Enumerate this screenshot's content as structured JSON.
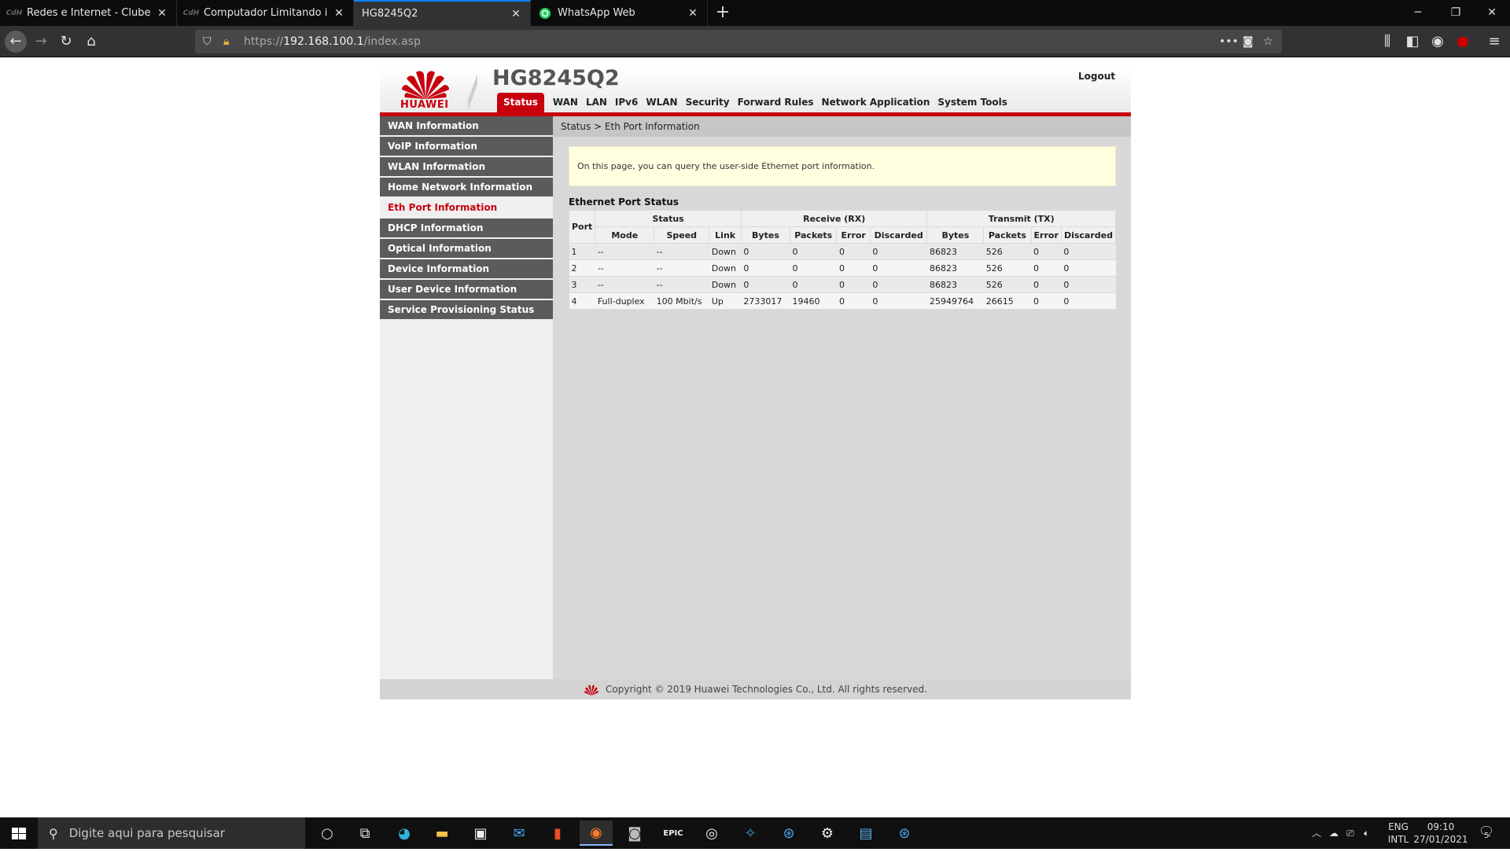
{
  "browser": {
    "tabs": [
      {
        "title": "Redes e Internet - Clube do Ha",
        "favicon": "clube-do-hardware-icon"
      },
      {
        "title": "Computador Limitando interne",
        "favicon": "clube-do-hardware-icon"
      },
      {
        "title": "HG8245Q2",
        "favicon": "none"
      },
      {
        "title": "WhatsApp Web",
        "favicon": "whatsapp-icon"
      }
    ],
    "url_prefix": "https://",
    "url_host": "192.168.100.1",
    "url_path": "/index.asp"
  },
  "router": {
    "brand": "HUAWEI",
    "model": "HG8245Q2",
    "logout": "Logout",
    "menu": [
      "Status",
      "WAN",
      "LAN",
      "IPv6",
      "WLAN",
      "Security",
      "Forward Rules",
      "Network Application",
      "System Tools"
    ],
    "sidebar": [
      "WAN Information",
      "VoIP Information",
      "WLAN Information",
      "Home Network Information",
      "Eth Port Information",
      "DHCP Information",
      "Optical Information",
      "Device Information",
      "User Device Information",
      "Service Provisioning Status"
    ],
    "breadcrumb": "Status > Eth Port Information",
    "notice": "On this page, you can query the user-side Ethernet port information.",
    "section_title": "Ethernet Port Status",
    "table": {
      "group_headers": {
        "port": "Port",
        "status": "Status",
        "rx": "Receive (RX)",
        "tx": "Transmit (TX)"
      },
      "sub_headers": [
        "Mode",
        "Speed",
        "Link",
        "Bytes",
        "Packets",
        "Error",
        "Discarded",
        "Bytes",
        "Packets",
        "Error",
        "Discarded"
      ],
      "rows": [
        [
          "1",
          "--",
          "--",
          "Down",
          "0",
          "0",
          "0",
          "0",
          "86823",
          "526",
          "0",
          "0"
        ],
        [
          "2",
          "--",
          "--",
          "Down",
          "0",
          "0",
          "0",
          "0",
          "86823",
          "526",
          "0",
          "0"
        ],
        [
          "3",
          "--",
          "--",
          "Down",
          "0",
          "0",
          "0",
          "0",
          "86823",
          "526",
          "0",
          "0"
        ],
        [
          "4",
          "Full-duplex",
          "100 Mbit/s",
          "Up",
          "2733017",
          "19460",
          "0",
          "0",
          "25949764",
          "26615",
          "0",
          "0"
        ]
      ]
    },
    "footer": "Copyright © 2019 Huawei Technologies Co., Ltd. All rights reserved."
  },
  "taskbar": {
    "search_placeholder": "Digite aqui para pesquisar",
    "lang1": "ENG",
    "lang2": "INTL",
    "time": "09:10",
    "date": "27/01/2021",
    "notifications": "5"
  },
  "colors": {
    "huawei_red": "#c8000e",
    "sidebar_gray": "#5b5b5b"
  }
}
